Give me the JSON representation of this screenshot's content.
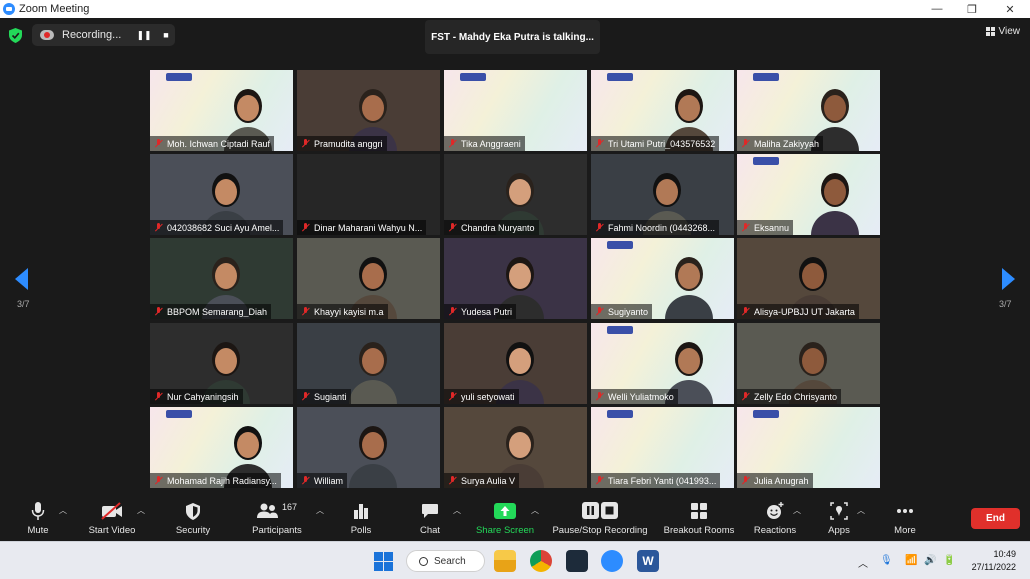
{
  "window": {
    "title": "Zoom Meeting",
    "controls": [
      "—",
      "❐",
      "✕"
    ]
  },
  "topbar": {
    "recording_label": "Recording...",
    "speaker_label": "FST - Mahdy Eka Putra is talking...",
    "view_label": "View"
  },
  "gallery": {
    "page_left": "3/7",
    "page_right": "3/7",
    "tiles": [
      {
        "name": "Moh. Ichwan Ciptadi Rauf",
        "kind": "slide-person"
      },
      {
        "name": "Pramudita anggri",
        "kind": "cam"
      },
      {
        "name": "Tika Anggraeni",
        "kind": "slide"
      },
      {
        "name": "Tri Utami Putri_043576532",
        "kind": "slide-person"
      },
      {
        "name": "Maliha Zakiyyah",
        "kind": "slide-person"
      },
      {
        "name": "042038682 Suci Ayu Amel...",
        "kind": "cam"
      },
      {
        "name": "Dinar Maharani Wahyu N...",
        "kind": "blank"
      },
      {
        "name": "Chandra Nuryanto",
        "kind": "cam"
      },
      {
        "name": "Fahmi Noordin (0443268...",
        "kind": "cam"
      },
      {
        "name": "Eksannu",
        "kind": "slide-person"
      },
      {
        "name": "BBPOM Semarang_Diah",
        "kind": "cam"
      },
      {
        "name": "Khayyi kayisi m.a",
        "kind": "cam"
      },
      {
        "name": "Yudesa Putri",
        "kind": "cam"
      },
      {
        "name": "Sugiyanto",
        "kind": "slide-person"
      },
      {
        "name": "Alisya-UPBJJ UT Jakarta",
        "kind": "cam"
      },
      {
        "name": "Nur Cahyaningsih",
        "kind": "cam"
      },
      {
        "name": "Sugianti",
        "kind": "cam"
      },
      {
        "name": "yuli setyowati",
        "kind": "cam"
      },
      {
        "name": "Welli Yuliatmoko",
        "kind": "slide-person"
      },
      {
        "name": "Zelly Edo Chrisyanto",
        "kind": "cam"
      },
      {
        "name": "Mohamad Rajih Radiansy...",
        "kind": "slide-person"
      },
      {
        "name": "William",
        "kind": "cam"
      },
      {
        "name": "Surya Aulia V",
        "kind": "cam"
      },
      {
        "name": "Tiara Febri Yanti (041993...",
        "kind": "slide"
      },
      {
        "name": "Julia Anugrah",
        "kind": "slide"
      }
    ]
  },
  "toolbar": {
    "mute": "Mute",
    "start_video": "Start Video",
    "security": "Security",
    "participants": "Participants",
    "participants_count": "167",
    "polls": "Polls",
    "chat": "Chat",
    "share_screen": "Share Screen",
    "pause_stop_recording": "Pause/Stop Recording",
    "breakout_rooms": "Breakout Rooms",
    "reactions": "Reactions",
    "apps": "Apps",
    "more": "More",
    "end": "End"
  },
  "taskbar": {
    "search_label": "Search",
    "time": "10:49",
    "date": "27/11/2022"
  },
  "colors": {
    "accent": "#2d8cff",
    "share_green": "#23d959",
    "end_red": "#e0302b",
    "muted_red": "#e02828"
  }
}
